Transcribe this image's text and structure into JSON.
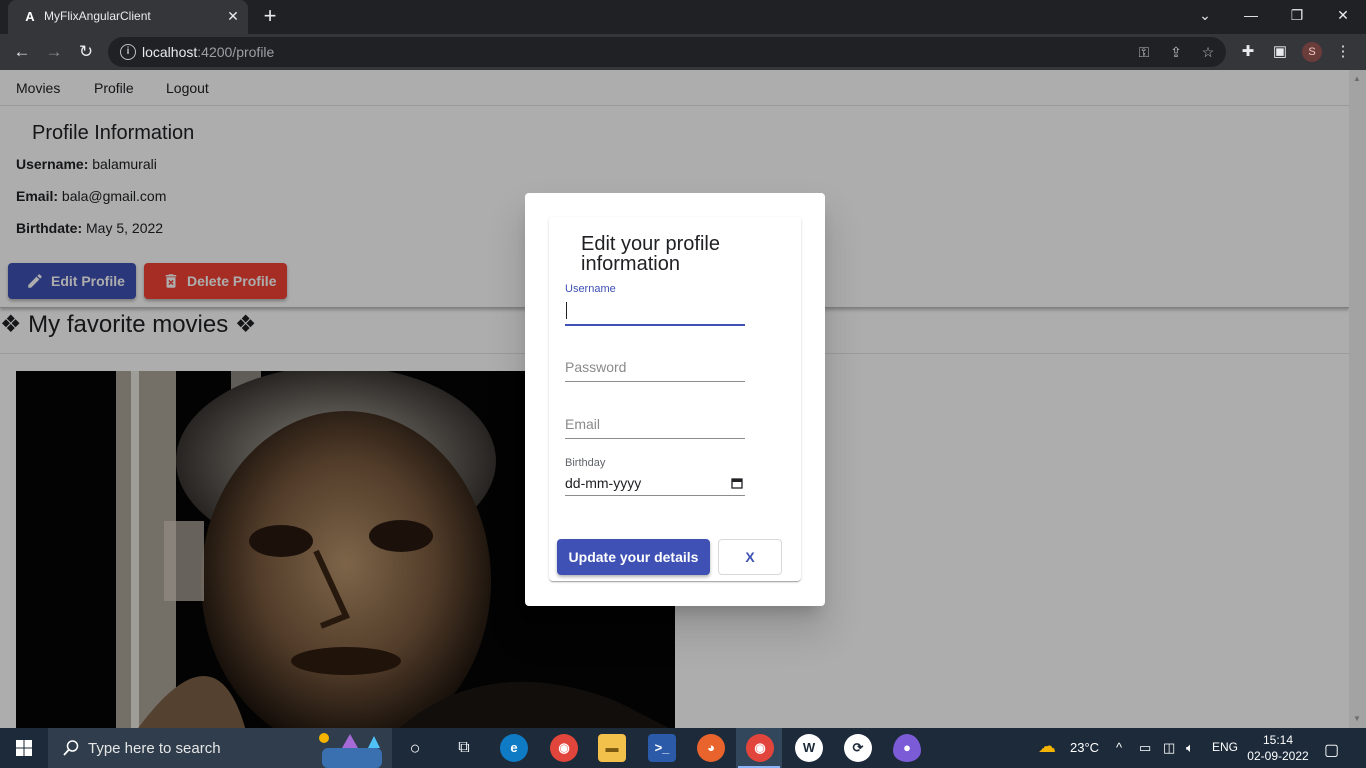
{
  "browser": {
    "tab_title": "MyFlixAngularClient",
    "tab_favicon": "A",
    "url_host": "localhost",
    "url_path": ":4200/profile",
    "profile_initial": "S"
  },
  "nav": {
    "movies": "Movies",
    "profile": "Profile",
    "logout": "Logout"
  },
  "profile": {
    "heading": "Profile Information",
    "username_label": "Username:",
    "username_value": "balamurali",
    "email_label": "Email:",
    "email_value": "bala@gmail.com",
    "birthdate_label": "Birthdate:",
    "birthdate_value": "May 5, 2022",
    "edit_button": "Edit Profile",
    "delete_button": "Delete Profile"
  },
  "favorites": {
    "heading": "❖ My favorite movies ❖"
  },
  "dialog": {
    "title": "Edit your profile information",
    "username_label": "Username",
    "username_value": "",
    "password_placeholder": "Password",
    "email_placeholder": "Email",
    "birthday_label": "Birthday",
    "birthday_value": "dd-mm-yyyy",
    "update_button": "Update your details",
    "close_button": "X"
  },
  "taskbar": {
    "search_placeholder": "Type here to search",
    "weather": "23°C",
    "language": "ENG",
    "time": "15:14",
    "date": "02-09-2022"
  },
  "colors": {
    "primary": "#3f51b5",
    "warn": "#f44336",
    "browser_dark": "#202124",
    "toolbar": "#35363a",
    "taskbar": "#1c2a3a"
  }
}
